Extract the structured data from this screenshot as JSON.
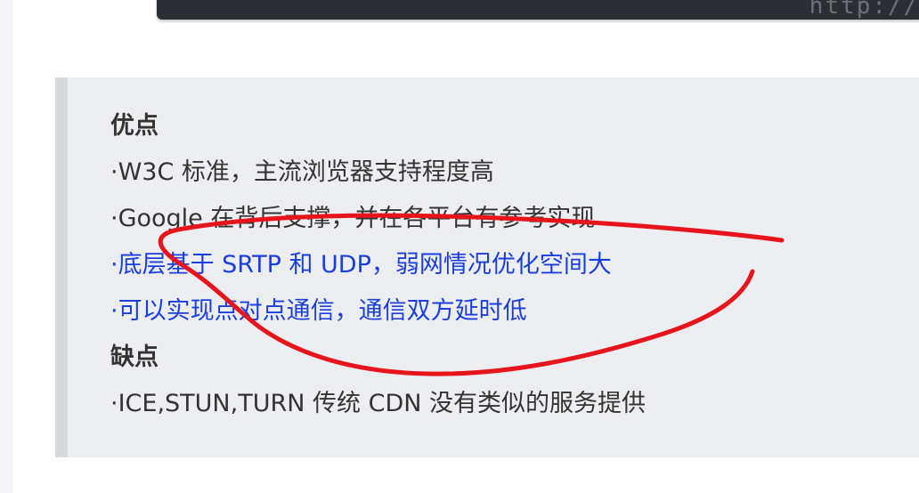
{
  "code_snippet": {
    "text": "http://b"
  },
  "content": {
    "pros_heading": "优点",
    "pros": [
      "·W3C 标准，主流浏览器支持程度高",
      "·Google 在背后支撑，并在各平台有参考实现",
      "·底层基于 SRTP 和 UDP，弱网情况优化空间大",
      "·可以实现点对点通信，通信双方延时低"
    ],
    "cons_heading": "缺点",
    "cons": [
      "·ICE,STUN,TURN 传统 CDN 没有类似的服务提供"
    ]
  },
  "colors": {
    "highlight_text": "#1a3fe0",
    "annotation_stroke": "#e8141c",
    "quote_background": "#edeef1",
    "quote_border": "#d7d9df"
  }
}
